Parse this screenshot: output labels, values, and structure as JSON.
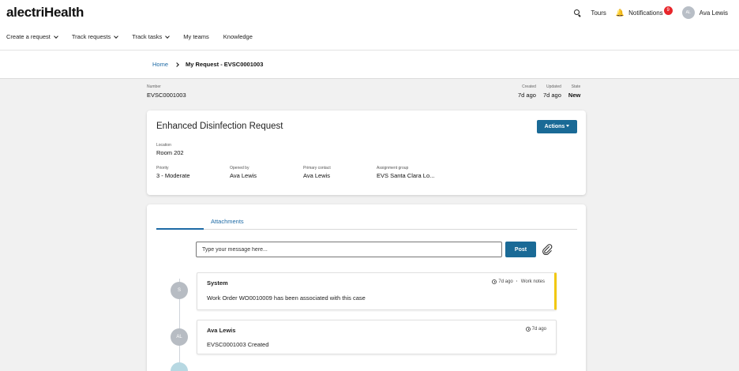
{
  "header": {
    "logo": "alectriHealth",
    "tours": "Tours",
    "notifications": "Notifications",
    "notification_count": "9",
    "user_initials": "AL",
    "user_name": "Ava Lewis"
  },
  "nav": [
    {
      "label": "Create a request",
      "dropdown": true
    },
    {
      "label": "Track requests",
      "dropdown": true
    },
    {
      "label": "Track tasks",
      "dropdown": true
    },
    {
      "label": "My teams",
      "dropdown": false
    },
    {
      "label": "Knowledge",
      "dropdown": false
    }
  ],
  "breadcrumb": {
    "home": "Home",
    "current": "My Request - EVSC0001003"
  },
  "meta": {
    "number_label": "Number",
    "number": "EVSC0001003",
    "created_label": "Created",
    "created": "7d ago",
    "updated_label": "Updated",
    "updated": "7d ago",
    "state_label": "State",
    "state": "New"
  },
  "request": {
    "title": "Enhanced Disinfection Request",
    "actions_label": "Actions",
    "location_label": "Location",
    "location": "Room 202",
    "priority_label": "Priority",
    "priority": "3 - Moderate",
    "opened_by_label": "Opened by",
    "opened_by": "Ava Lewis",
    "primary_contact_label": "Primary contact",
    "primary_contact": "Ava Lewis",
    "assignment_group_label": "Assignment group",
    "assignment_group": "EVS Santa Clara Lo..."
  },
  "activity": {
    "tab_label": "Attachments",
    "input_placeholder": "Type your message here...",
    "post_label": "Post",
    "entries": [
      {
        "initials": "S",
        "author": "System",
        "time": "7d ago",
        "tag": "Work notes",
        "body": "Work Order WO0010009 has been associated with this case"
      },
      {
        "initials": "AL",
        "author": "Ava Lewis",
        "time": "7d ago",
        "tag": "",
        "body": "EVSC0001003 Created"
      }
    ]
  },
  "colors": {
    "primary": "#1a6a96",
    "link": "#1d6aa5",
    "badge": "#e8262b",
    "work_note_accent": "#f2c811"
  }
}
